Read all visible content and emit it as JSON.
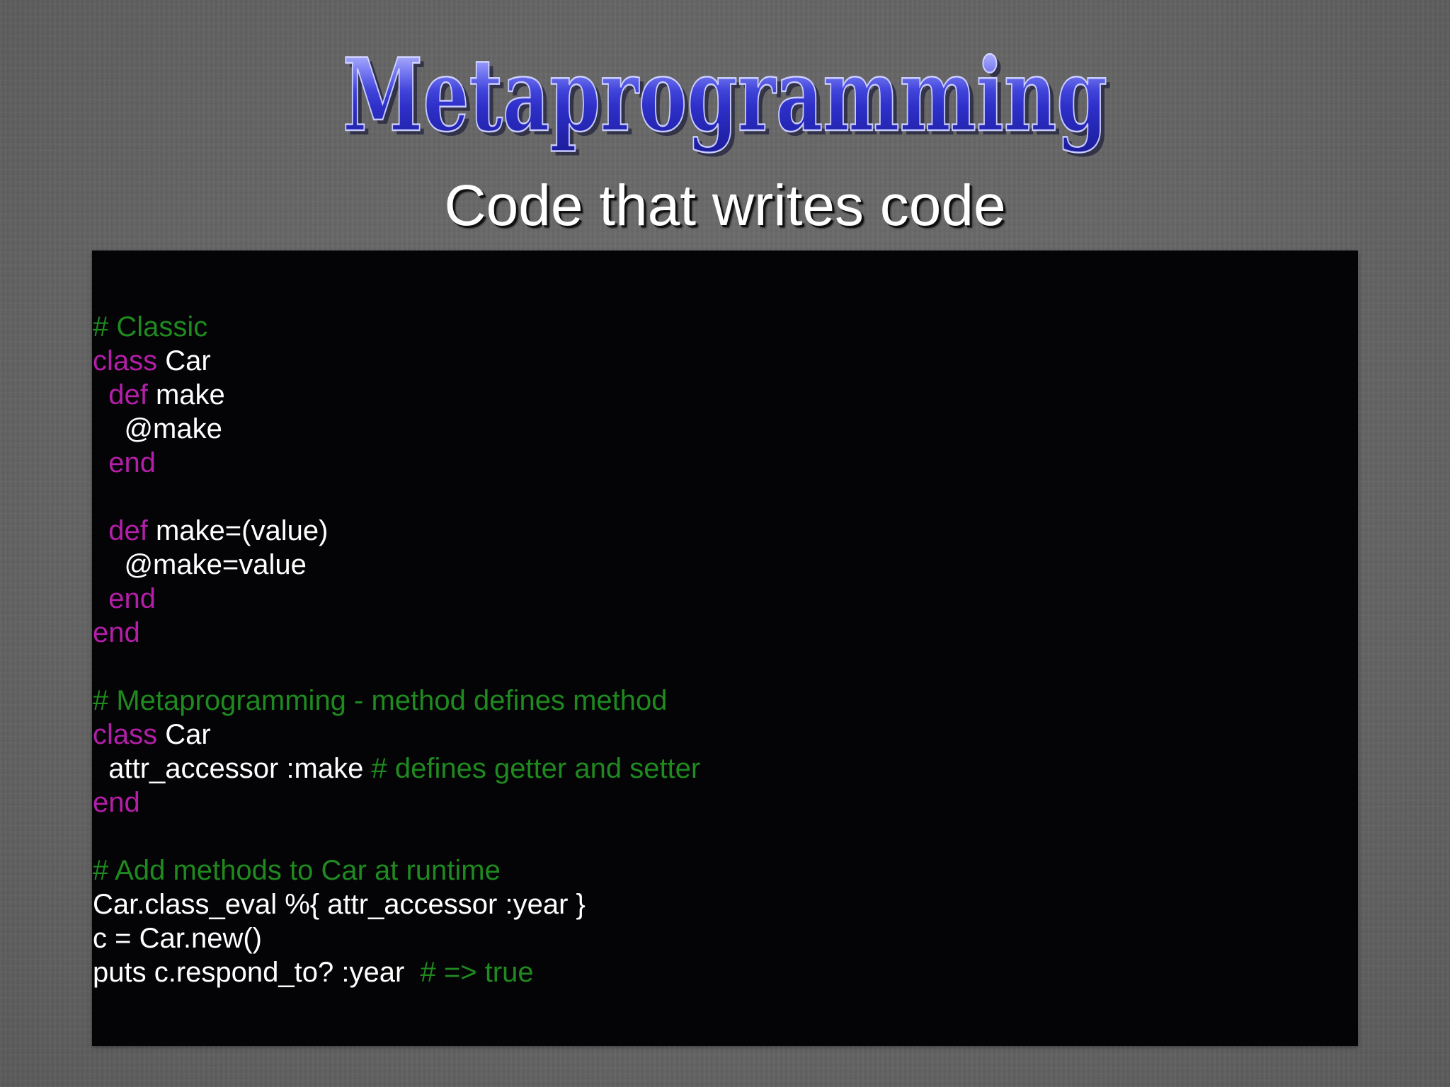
{
  "slide": {
    "title": "Metaprogramming",
    "subtitle": "Code that writes code"
  },
  "colors": {
    "background": "#6a6a6a",
    "panel": "#040305",
    "title_blue": "#3b3fd0",
    "comment": "#1f8a1f",
    "keyword": "#b31fa8",
    "text": "#ffffff"
  },
  "code": {
    "lines": [
      [
        {
          "t": "# Classic",
          "k": "comment"
        }
      ],
      [
        {
          "t": "class",
          "k": "keyword"
        },
        {
          "t": " Car",
          "k": "plain"
        }
      ],
      [
        {
          "t": "  ",
          "k": "plain"
        },
        {
          "t": "def",
          "k": "keyword"
        },
        {
          "t": " make",
          "k": "plain"
        }
      ],
      [
        {
          "t": "    @make",
          "k": "plain"
        }
      ],
      [
        {
          "t": "  ",
          "k": "plain"
        },
        {
          "t": "end",
          "k": "keyword"
        }
      ],
      [],
      [
        {
          "t": "  ",
          "k": "plain"
        },
        {
          "t": "def",
          "k": "keyword"
        },
        {
          "t": " make=(value)",
          "k": "plain"
        }
      ],
      [
        {
          "t": "    @make=value",
          "k": "plain"
        }
      ],
      [
        {
          "t": "  ",
          "k": "plain"
        },
        {
          "t": "end",
          "k": "keyword"
        }
      ],
      [
        {
          "t": "end",
          "k": "keyword"
        }
      ],
      [],
      [
        {
          "t": "# Metaprogramming - method defines method",
          "k": "comment"
        }
      ],
      [
        {
          "t": "class",
          "k": "keyword"
        },
        {
          "t": " Car",
          "k": "plain"
        }
      ],
      [
        {
          "t": "  attr_accessor :make ",
          "k": "plain"
        },
        {
          "t": "# defines getter and setter",
          "k": "comment"
        }
      ],
      [
        {
          "t": "end",
          "k": "keyword"
        }
      ],
      [],
      [
        {
          "t": "# Add methods to Car at runtime",
          "k": "comment"
        }
      ],
      [
        {
          "t": "Car.class_eval %{ attr_accessor :year }",
          "k": "plain"
        }
      ],
      [
        {
          "t": "c = Car.new()",
          "k": "plain"
        }
      ],
      [
        {
          "t": "puts c.respond_to? :year  ",
          "k": "plain"
        },
        {
          "t": "# => true",
          "k": "comment"
        }
      ]
    ]
  }
}
